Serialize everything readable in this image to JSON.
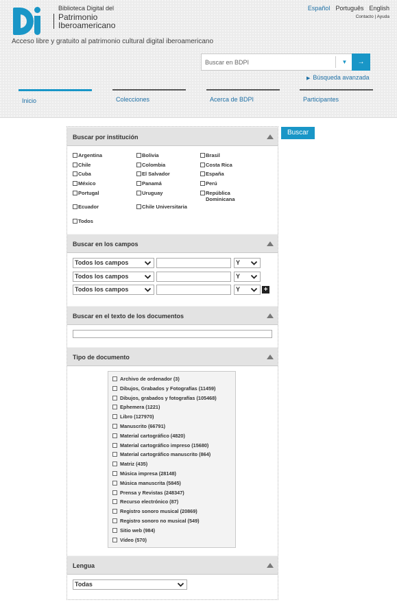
{
  "header": {
    "brand_small": "Biblioteca Digital del",
    "brand_line1": "Patrimonio",
    "brand_line2": "Iberoamericano",
    "tagline": "Acceso libre y gratuito al patrimonio cultural digital iberoamericano",
    "languages": [
      "Español",
      "Português",
      "English"
    ],
    "links": [
      "Contacto",
      "Ayuda"
    ],
    "search_placeholder": "Buscar en BDPI",
    "advanced_search": "Búsqueda avanzada",
    "accent_color": "#1996c7",
    "link_color": "#1d6fa5"
  },
  "nav": {
    "tabs": [
      {
        "label": "Inicio"
      },
      {
        "label": "Colecciones"
      },
      {
        "label": "Acerca de BDPI"
      },
      {
        "label": "Participantes"
      }
    ]
  },
  "form": {
    "submit_label": "Buscar",
    "institution": {
      "title": "Buscar por institución",
      "countries": [
        "Argentina",
        "Bolivia",
        "Brasil",
        "Chile",
        "Colombia",
        "Costa Rica",
        "Cuba",
        "El Salvador",
        "España",
        "México",
        "Panamá",
        "Perú",
        "Portugal",
        "Uruguay",
        "República Dominicana",
        "Ecuador",
        "Chile Universitaria",
        "Todos"
      ]
    },
    "fields": {
      "title": "Buscar en los campos",
      "field_select": "Todos los campos",
      "operator_select": "Y"
    },
    "fulltext": {
      "title": "Buscar en el texto de los documentos"
    },
    "doctype": {
      "title": "Tipo de documento",
      "items": [
        "Archivo de ordenador (3)",
        "Dibujos, Grabados y Fotografías (11459)",
        "Dibujos, grabados y fotografías (105468)",
        "Ephemera (1221)",
        "Libro (127970)",
        "Manuscrito (66791)",
        "Material cartográfico (4820)",
        "Material cartográfico impreso (15680)",
        "Material cartográfico manuscrito (864)",
        "Matriz (435)",
        "Música impresa (28148)",
        "Música manuscrita (5845)",
        "Prensa y Revistas (248347)",
        "Recurso electrónico (87)",
        "Registro sonoro musical (20869)",
        "Registro sonoro no musical (549)",
        "Sitio web (984)",
        "Vídeo (570)"
      ]
    },
    "language": {
      "title": "Lengua",
      "select": "Todas"
    }
  }
}
